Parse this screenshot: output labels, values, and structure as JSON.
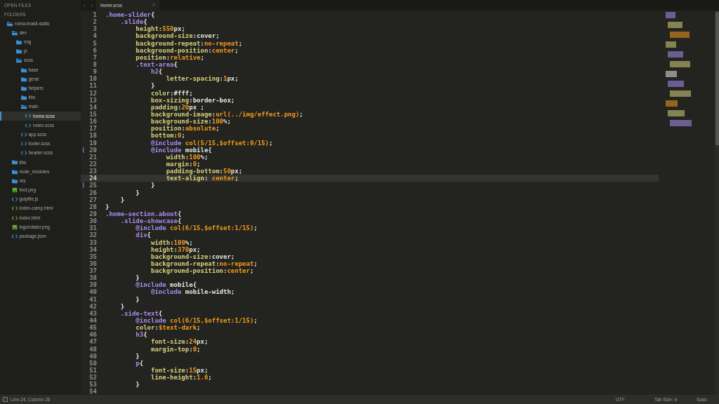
{
  "sidebar": {
    "open_files_label": "OPEN FILES",
    "folders_label": "FOLDERS",
    "tree": [
      {
        "name": "roma-brasil-static",
        "kind": "folder",
        "expanded": true,
        "selected": false,
        "children": [
          {
            "name": "dev",
            "kind": "folder",
            "expanded": true,
            "selected": false,
            "children": [
              {
                "name": "img",
                "kind": "folder",
                "expanded": false,
                "selected": false
              },
              {
                "name": "js",
                "kind": "folder",
                "expanded": false,
                "selected": false
              },
              {
                "name": "scss",
                "kind": "folder",
                "expanded": true,
                "selected": false,
                "children": [
                  {
                    "name": "base",
                    "kind": "folder",
                    "expanded": false,
                    "selected": false
                  },
                  {
                    "name": "geral",
                    "kind": "folder",
                    "expanded": false,
                    "selected": false
                  },
                  {
                    "name": "helpers",
                    "kind": "folder",
                    "expanded": false,
                    "selected": false
                  },
                  {
                    "name": "libs",
                    "kind": "folder",
                    "expanded": false,
                    "selected": false
                  },
                  {
                    "name": "main",
                    "kind": "folder",
                    "expanded": true,
                    "selected": false,
                    "children": [
                      {
                        "name": "home.scss",
                        "kind": "code",
                        "selected": true
                      },
                      {
                        "name": "index.scss",
                        "kind": "code",
                        "selected": false
                      }
                    ]
                  },
                  {
                    "name": "app.scss",
                    "kind": "code",
                    "selected": false
                  },
                  {
                    "name": "footer.scss",
                    "kind": "code",
                    "selected": false
                  },
                  {
                    "name": "header.scss",
                    "kind": "code",
                    "selected": false
                  }
                ]
              }
            ]
          },
          {
            "name": "libs",
            "kind": "folder",
            "expanded": false,
            "selected": false
          },
          {
            "name": "node_modules",
            "kind": "folder",
            "expanded": false,
            "selected": false
          },
          {
            "name": "res",
            "kind": "folder",
            "expanded": false,
            "selected": false
          },
          {
            "name": "foot.png",
            "kind": "image",
            "selected": false
          },
          {
            "name": "gulpfile.js",
            "kind": "code",
            "selected": false
          },
          {
            "name": "index-comp.html",
            "kind": "markup",
            "selected": false
          },
          {
            "name": "index.html",
            "kind": "markup",
            "selected": false
          },
          {
            "name": "logorotator.png",
            "kind": "image",
            "selected": false
          },
          {
            "name": "package.json",
            "kind": "code",
            "selected": false
          }
        ]
      }
    ]
  },
  "tabs": [
    {
      "label": "home.scss",
      "close": "×",
      "selected": true
    }
  ],
  "editor": {
    "lines": [
      {
        "number": "1",
        "current": false,
        "tokens": [
          {
            "text": ".home-slider",
            "kind": "sel"
          },
          {
            "text": "{",
            "kind": "punct"
          }
        ]
      },
      {
        "number": "2",
        "current": false,
        "tokens": [
          {
            "text": "    .slide",
            "kind": "sel"
          },
          {
            "text": "{",
            "kind": "punct"
          }
        ]
      },
      {
        "number": "3",
        "current": false,
        "tokens": [
          {
            "text": "        height",
            "kind": "prop"
          },
          {
            "text": ":",
            "kind": "punct"
          },
          {
            "text": "550",
            "kind": "num"
          },
          {
            "text": "px;",
            "kind": "val"
          }
        ]
      },
      {
        "number": "4",
        "current": false,
        "tokens": [
          {
            "text": "        background-size",
            "kind": "prop"
          },
          {
            "text": ":",
            "kind": "punct"
          },
          {
            "text": "cover;",
            "kind": "val"
          }
        ]
      },
      {
        "number": "5",
        "current": false,
        "tokens": [
          {
            "text": "        background-repeat",
            "kind": "prop"
          },
          {
            "text": ":",
            "kind": "punct"
          },
          {
            "text": "no-repeat",
            "kind": "kw"
          },
          {
            "text": ";",
            "kind": "punct"
          }
        ]
      },
      {
        "number": "6",
        "current": false,
        "tokens": [
          {
            "text": "        background-position",
            "kind": "prop"
          },
          {
            "text": ":",
            "kind": "punct"
          },
          {
            "text": "center",
            "kind": "kw"
          },
          {
            "text": ";",
            "kind": "punct"
          }
        ]
      },
      {
        "number": "7",
        "current": false,
        "tokens": [
          {
            "text": "        position",
            "kind": "prop"
          },
          {
            "text": ":",
            "kind": "punct"
          },
          {
            "text": "relative",
            "kind": "kw"
          },
          {
            "text": ";",
            "kind": "punct"
          }
        ]
      },
      {
        "number": "8",
        "current": false,
        "tokens": [
          {
            "text": "        .text-area",
            "kind": "sel"
          },
          {
            "text": "{",
            "kind": "punct"
          }
        ]
      },
      {
        "number": "9",
        "current": false,
        "tokens": [
          {
            "text": "            h2",
            "kind": "sel"
          },
          {
            "text": "{",
            "kind": "punct"
          }
        ]
      },
      {
        "number": "10",
        "current": false,
        "tokens": [
          {
            "text": "                letter-spacing",
            "kind": "prop"
          },
          {
            "text": ":",
            "kind": "punct"
          },
          {
            "text": "1",
            "kind": "num"
          },
          {
            "text": "px;",
            "kind": "val"
          }
        ]
      },
      {
        "number": "11",
        "current": false,
        "tokens": [
          {
            "text": "            }",
            "kind": "punct"
          }
        ]
      },
      {
        "number": "12",
        "current": false,
        "tokens": [
          {
            "text": "            color",
            "kind": "prop"
          },
          {
            "text": ":",
            "kind": "punct"
          },
          {
            "text": "#fff",
            "kind": "val"
          },
          {
            "text": ";",
            "kind": "punct"
          }
        ]
      },
      {
        "number": "13",
        "current": false,
        "tokens": [
          {
            "text": "            box-sizing",
            "kind": "prop"
          },
          {
            "text": ":",
            "kind": "punct"
          },
          {
            "text": "border-box;",
            "kind": "val"
          }
        ]
      },
      {
        "number": "14",
        "current": false,
        "tokens": [
          {
            "text": "            padding",
            "kind": "prop"
          },
          {
            "text": ":",
            "kind": "punct"
          },
          {
            "text": "20",
            "kind": "num"
          },
          {
            "text": "px ;",
            "kind": "val"
          }
        ]
      },
      {
        "number": "15",
        "current": false,
        "tokens": [
          {
            "text": "            background-image",
            "kind": "prop"
          },
          {
            "text": ":",
            "kind": "punct"
          },
          {
            "text": "url(../img/effect.png)",
            "kind": "kw"
          },
          {
            "text": ";",
            "kind": "punct"
          }
        ]
      },
      {
        "number": "16",
        "current": false,
        "tokens": [
          {
            "text": "            background-size",
            "kind": "prop"
          },
          {
            "text": ":",
            "kind": "punct"
          },
          {
            "text": "100",
            "kind": "num"
          },
          {
            "text": "%;",
            "kind": "val"
          }
        ]
      },
      {
        "number": "17",
        "current": false,
        "tokens": [
          {
            "text": "            position",
            "kind": "prop"
          },
          {
            "text": ":",
            "kind": "punct"
          },
          {
            "text": "absolute",
            "kind": "kw"
          },
          {
            "text": ";",
            "kind": "punct"
          }
        ]
      },
      {
        "number": "18",
        "current": false,
        "tokens": [
          {
            "text": "            bottom",
            "kind": "prop"
          },
          {
            "text": ":",
            "kind": "punct"
          },
          {
            "text": "0",
            "kind": "num"
          },
          {
            "text": ";",
            "kind": "punct"
          }
        ]
      },
      {
        "number": "19",
        "current": false,
        "tokens": [
          {
            "text": "            @include",
            "kind": "at"
          },
          {
            "text": " col(5/15,$offset:9/15)",
            "kind": "kw"
          },
          {
            "text": ";",
            "kind": "punct"
          }
        ]
      },
      {
        "number": "20",
        "current": false,
        "fold": "(",
        "tokens": [
          {
            "text": "            @include",
            "kind": "at"
          },
          {
            "text": " mobile{",
            "kind": "val"
          }
        ]
      },
      {
        "number": "21",
        "current": false,
        "tokens": [
          {
            "text": "                width",
            "kind": "prop"
          },
          {
            "text": ":",
            "kind": "punct"
          },
          {
            "text": "100",
            "kind": "num"
          },
          {
            "text": "%;",
            "kind": "val"
          }
        ]
      },
      {
        "number": "22",
        "current": false,
        "tokens": [
          {
            "text": "                margin",
            "kind": "prop"
          },
          {
            "text": ":",
            "kind": "punct"
          },
          {
            "text": "0",
            "kind": "num"
          },
          {
            "text": ";",
            "kind": "punct"
          }
        ]
      },
      {
        "number": "23",
        "current": false,
        "tokens": [
          {
            "text": "                padding-bottom",
            "kind": "prop"
          },
          {
            "text": ":",
            "kind": "punct"
          },
          {
            "text": "50",
            "kind": "num"
          },
          {
            "text": "px;",
            "kind": "val"
          }
        ]
      },
      {
        "number": "24",
        "current": true,
        "tokens": [
          {
            "text": "                text-align",
            "kind": "prop"
          },
          {
            "text": ": ",
            "kind": "punct"
          },
          {
            "text": "center",
            "kind": "kw"
          },
          {
            "text": ";",
            "kind": "punct"
          }
        ]
      },
      {
        "number": "25",
        "current": false,
        "fold": ")",
        "tokens": [
          {
            "text": "            }",
            "kind": "punct"
          }
        ]
      },
      {
        "number": "26",
        "current": false,
        "tokens": [
          {
            "text": "        }",
            "kind": "punct"
          }
        ]
      },
      {
        "number": "27",
        "current": false,
        "tokens": [
          {
            "text": "    }",
            "kind": "punct"
          }
        ]
      },
      {
        "number": "28",
        "current": false,
        "tokens": [
          {
            "text": "}",
            "kind": "punct"
          }
        ]
      },
      {
        "number": "29",
        "current": false,
        "tokens": [
          {
            "text": ".home-section.about",
            "kind": "sel"
          },
          {
            "text": "{",
            "kind": "punct"
          }
        ]
      },
      {
        "number": "30",
        "current": false,
        "tokens": [
          {
            "text": "    .slide-showcase",
            "kind": "sel"
          },
          {
            "text": "{",
            "kind": "punct"
          }
        ]
      },
      {
        "number": "31",
        "current": false,
        "tokens": [
          {
            "text": "        @include",
            "kind": "at"
          },
          {
            "text": " col(6/15,$offset:1/15)",
            "kind": "kw"
          },
          {
            "text": ";",
            "kind": "punct"
          }
        ]
      },
      {
        "number": "32",
        "current": false,
        "tokens": [
          {
            "text": "        div",
            "kind": "sel"
          },
          {
            "text": "{",
            "kind": "punct"
          }
        ]
      },
      {
        "number": "33",
        "current": false,
        "tokens": [
          {
            "text": "            width",
            "kind": "prop"
          },
          {
            "text": ":",
            "kind": "punct"
          },
          {
            "text": "100",
            "kind": "num"
          },
          {
            "text": "%;",
            "kind": "val"
          }
        ]
      },
      {
        "number": "34",
        "current": false,
        "tokens": [
          {
            "text": "            height",
            "kind": "prop"
          },
          {
            "text": ":",
            "kind": "punct"
          },
          {
            "text": "370",
            "kind": "num"
          },
          {
            "text": "px;",
            "kind": "val"
          }
        ]
      },
      {
        "number": "35",
        "current": false,
        "tokens": [
          {
            "text": "            background-size",
            "kind": "prop"
          },
          {
            "text": ":",
            "kind": "punct"
          },
          {
            "text": "cover;",
            "kind": "val"
          }
        ]
      },
      {
        "number": "36",
        "current": false,
        "tokens": [
          {
            "text": "            background-repeat",
            "kind": "prop"
          },
          {
            "text": ":",
            "kind": "punct"
          },
          {
            "text": "no-repeat",
            "kind": "kw"
          },
          {
            "text": ";",
            "kind": "punct"
          }
        ]
      },
      {
        "number": "37",
        "current": false,
        "tokens": [
          {
            "text": "            background-position",
            "kind": "prop"
          },
          {
            "text": ":",
            "kind": "punct"
          },
          {
            "text": "center",
            "kind": "kw"
          },
          {
            "text": ";",
            "kind": "punct"
          }
        ]
      },
      {
        "number": "38",
        "current": false,
        "tokens": [
          {
            "text": "        }",
            "kind": "punct"
          }
        ]
      },
      {
        "number": "39",
        "current": false,
        "tokens": [
          {
            "text": "        @include",
            "kind": "at"
          },
          {
            "text": " mobile{",
            "kind": "val"
          }
        ]
      },
      {
        "number": "40",
        "current": false,
        "tokens": [
          {
            "text": "            @include",
            "kind": "at"
          },
          {
            "text": " mobile-width;",
            "kind": "val"
          }
        ]
      },
      {
        "number": "41",
        "current": false,
        "tokens": [
          {
            "text": "        }",
            "kind": "punct"
          }
        ]
      },
      {
        "number": "42",
        "current": false,
        "tokens": [
          {
            "text": "    }",
            "kind": "punct"
          }
        ]
      },
      {
        "number": "43",
        "current": false,
        "tokens": [
          {
            "text": "    .side-text",
            "kind": "sel"
          },
          {
            "text": "{",
            "kind": "punct"
          }
        ]
      },
      {
        "number": "44",
        "current": false,
        "tokens": [
          {
            "text": "        @include",
            "kind": "at"
          },
          {
            "text": " col(6/15,$offset:1/15)",
            "kind": "kw"
          },
          {
            "text": ";",
            "kind": "punct"
          }
        ]
      },
      {
        "number": "45",
        "current": false,
        "tokens": [
          {
            "text": "        color",
            "kind": "prop"
          },
          {
            "text": ":",
            "kind": "punct"
          },
          {
            "text": "$text-dark",
            "kind": "kw"
          },
          {
            "text": ";",
            "kind": "punct"
          }
        ]
      },
      {
        "number": "46",
        "current": false,
        "tokens": [
          {
            "text": "        h3",
            "kind": "sel"
          },
          {
            "text": "{",
            "kind": "punct"
          }
        ]
      },
      {
        "number": "47",
        "current": false,
        "tokens": [
          {
            "text": "            font-size",
            "kind": "prop"
          },
          {
            "text": ":",
            "kind": "punct"
          },
          {
            "text": "24",
            "kind": "num"
          },
          {
            "text": "px;",
            "kind": "val"
          }
        ]
      },
      {
        "number": "48",
        "current": false,
        "tokens": [
          {
            "text": "            margin-top",
            "kind": "prop"
          },
          {
            "text": ":",
            "kind": "punct"
          },
          {
            "text": "0",
            "kind": "num"
          },
          {
            "text": ";",
            "kind": "punct"
          }
        ]
      },
      {
        "number": "49",
        "current": false,
        "tokens": [
          {
            "text": "        }",
            "kind": "punct"
          }
        ]
      },
      {
        "number": "50",
        "current": false,
        "tokens": [
          {
            "text": "        p",
            "kind": "sel"
          },
          {
            "text": "{",
            "kind": "punct"
          }
        ]
      },
      {
        "number": "51",
        "current": false,
        "tokens": [
          {
            "text": "            font-size",
            "kind": "prop"
          },
          {
            "text": ":",
            "kind": "punct"
          },
          {
            "text": "15",
            "kind": "num"
          },
          {
            "text": "px;",
            "kind": "val"
          }
        ]
      },
      {
        "number": "52",
        "current": false,
        "tokens": [
          {
            "text": "            line-height",
            "kind": "prop"
          },
          {
            "text": ":",
            "kind": "punct"
          },
          {
            "text": "1.6",
            "kind": "num"
          },
          {
            "text": ";",
            "kind": "punct"
          }
        ]
      },
      {
        "number": "53",
        "current": false,
        "tokens": [
          {
            "text": "        }",
            "kind": "punct"
          }
        ]
      },
      {
        "number": "54",
        "current": false
      }
    ]
  },
  "status_bar": {
    "position": "Line 24, Column 26",
    "encoding": "UTF",
    "tab_size": "Tab Size: 4",
    "syntax": "Sass"
  }
}
